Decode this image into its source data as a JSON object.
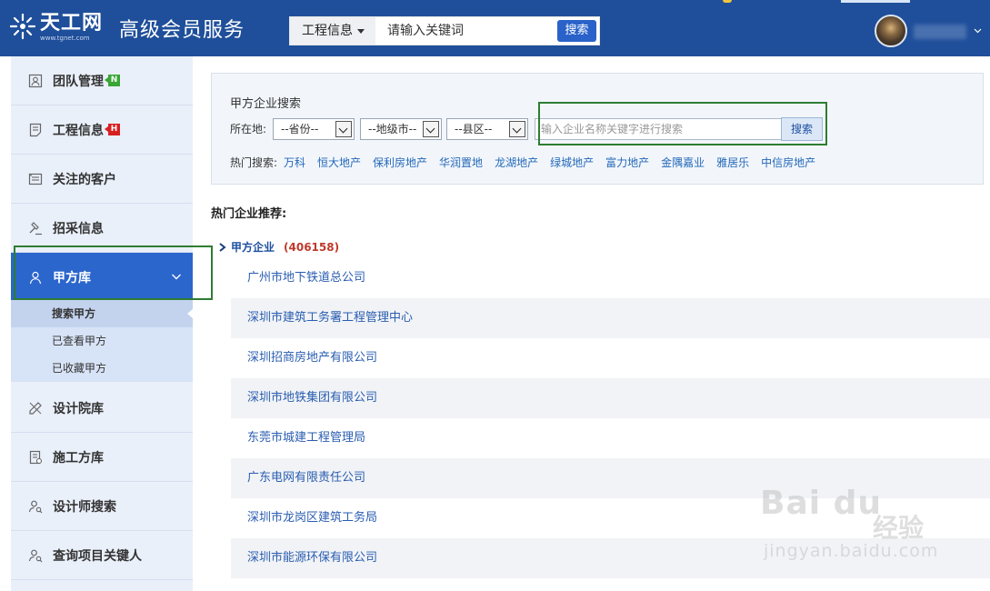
{
  "header": {
    "logo_text": "天工网",
    "logo_url": "www.tgnet.com",
    "title": "高级会员服务",
    "search": {
      "category": "工程信息",
      "placeholder": "请输入关键词",
      "button": "搜索"
    }
  },
  "sidebar": {
    "items": [
      {
        "label": "团队管理",
        "badge": "N",
        "icon": "team-icon"
      },
      {
        "label": "工程信息",
        "badge": "H",
        "icon": "project-icon"
      },
      {
        "label": "关注的客户",
        "icon": "follow-icon"
      },
      {
        "label": "招采信息",
        "icon": "bid-icon"
      },
      {
        "label": "甲方库",
        "icon": "user-icon",
        "active": true
      },
      {
        "label": "设计院库",
        "icon": "design-icon"
      },
      {
        "label": "施工方库",
        "icon": "construction-icon"
      },
      {
        "label": "设计师搜索",
        "icon": "designer-icon"
      },
      {
        "label": "查询项目关键人",
        "icon": "keyperson-icon"
      }
    ],
    "sub_items": [
      "搜索甲方",
      "已查看甲方",
      "已收藏甲方"
    ]
  },
  "search_panel": {
    "title": "甲方企业搜索",
    "location_label": "所在地:",
    "province": "--省份--",
    "city": "--地级市--",
    "county": "--县区--",
    "keyword_placeholder": "输入企业名称关键字进行搜索",
    "button": "搜索",
    "hot_label": "热门搜索:",
    "hot_links": [
      "万科",
      "恒大地产",
      "保利房地产",
      "华润置地",
      "龙湖地产",
      "绿城地产",
      "富力地产",
      "金隅嘉业",
      "雅居乐",
      "中信房地产"
    ]
  },
  "recommend": {
    "title": "热门企业推荐:",
    "category": "甲方企业",
    "count": "(406158)",
    "companies": [
      "广州市地下铁道总公司",
      "深圳市建筑工务署工程管理中心",
      "深圳招商房地产有限公司",
      "深圳市地铁集团有限公司",
      "东莞市城建工程管理局",
      "广东电网有限责任公司",
      "深圳市龙岗区建筑工务局",
      "深圳市能源环保有限公司"
    ]
  },
  "watermark": {
    "logo": "Bai du",
    "cn": "经验",
    "url": "jingyan.baidu.com"
  },
  "colors": {
    "header_bg": "#1f4f9a",
    "sidebar_bg": "#eaf0fa",
    "active_bg": "#2b66cc",
    "link": "#2468b8",
    "highlight_box": "#2e7d32"
  }
}
